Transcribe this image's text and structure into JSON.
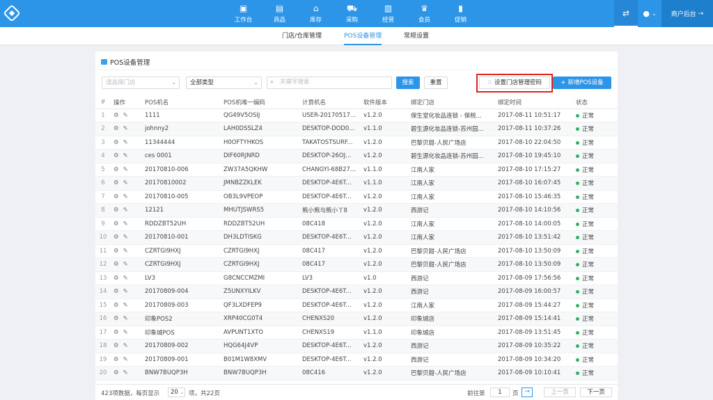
{
  "topnav": {
    "items": [
      {
        "label": "工作台",
        "icon": "monitor-icon",
        "glyph": "▣"
      },
      {
        "label": "商品",
        "icon": "product-icon",
        "glyph": "▤"
      },
      {
        "label": "库存",
        "icon": "warehouse-icon",
        "glyph": "⌂"
      },
      {
        "label": "采购",
        "icon": "cart-icon",
        "glyph": "⛟"
      },
      {
        "label": "经营",
        "icon": "store-icon",
        "glyph": "▥"
      },
      {
        "label": "会员",
        "icon": "crown-icon",
        "glyph": "♛"
      },
      {
        "label": "促销",
        "icon": "promotion-icon",
        "glyph": "▮"
      }
    ],
    "merchant_label": "商户后台",
    "merchant_arrow": "→",
    "settings_glyph": "⇄",
    "user_glyph": "●",
    "user_caret": "⌄"
  },
  "subnav": {
    "tabs": [
      "门店/仓库管理",
      "POS设备管理",
      "常规设置"
    ],
    "active": 1
  },
  "card": {
    "title": "POS设备管理"
  },
  "filters": {
    "store_placeholder": "请选择门店",
    "type_value": "全部类型",
    "search_placeholder": "关键字搜索",
    "search_button": "搜索",
    "reset_button": "重置",
    "set_password_button": "设置门店管理密码",
    "add_pos_button": "新增POS设备",
    "caret": "⌄",
    "search_glyph": "⌕",
    "grid_glyph": "⁙",
    "plus_glyph": "+"
  },
  "table": {
    "headers": [
      "#",
      "操作",
      "POS机名",
      "POS机唯一编码",
      "计算机名",
      "软件版本",
      "绑定门店",
      "绑定时间",
      "状态"
    ],
    "op_icons": {
      "settings": "⚙",
      "edit": "✎"
    },
    "rows": [
      {
        "num": "1",
        "name": "1111",
        "code": "QG49V5OSIJ",
        "computer": "USER-20170517...",
        "version": "v1.2.0",
        "store": "保生堂化妆品连锁 - 保税...",
        "time": "2017-08-11 10:51:17",
        "status": "正常"
      },
      {
        "num": "2",
        "name": "johnny2",
        "code": "LAH0DSSLZ4",
        "computer": "DESKTOP-DOD0...",
        "version": "v1.1.0",
        "store": "碧生源化妆品连锁-苏州园...",
        "time": "2017-08-11 10:37:26",
        "status": "正常"
      },
      {
        "num": "3",
        "name": "11344444",
        "code": "H0OFTYHKOS",
        "computer": "TAKATOSTSURF...",
        "version": "v1.2.0",
        "store": "巴黎贝甜-人民广场店",
        "time": "2017-08-10 22:04:50",
        "status": "正常"
      },
      {
        "num": "4",
        "name": "ces 0001",
        "code": "DIF60RJNRD",
        "computer": "DESKTOP-26OJ...",
        "version": "v1.2.0",
        "store": "碧生源化妆品连锁-苏州园...",
        "time": "2017-08-10 19:45:10",
        "status": "正常"
      },
      {
        "num": "5",
        "name": "20170810-006",
        "code": "ZW37A5QKHW",
        "computer": "CHANGYI-68B27...",
        "version": "v1.1.0",
        "store": "江南人家",
        "time": "2017-08-10 17:15:27",
        "status": "正常"
      },
      {
        "num": "6",
        "name": "20170810002",
        "code": "JMNBZZKLEK",
        "computer": "DESKTOP-4E6T...",
        "version": "v1.1.0",
        "store": "江南人家",
        "time": "2017-08-10 16:07:45",
        "status": "正常"
      },
      {
        "num": "7",
        "name": "20170810-005",
        "code": "OB3L9VPEOP",
        "computer": "DESKTOP-4E6T...",
        "version": "v1.2.0",
        "store": "江南人家",
        "time": "2017-08-10 15:46:35",
        "status": "正常"
      },
      {
        "num": "8",
        "name": "12121",
        "code": "MHUTJSWRS5",
        "computer": "熊小熊与熊小丫8",
        "version": "v1.2.0",
        "store": "西游记",
        "time": "2017-08-10 14:10:56",
        "status": "正常"
      },
      {
        "num": "9",
        "name": "RDDZBT52UH",
        "code": "RDDZBT52UH",
        "computer": "08C418",
        "version": "v1.2.0",
        "store": "江南人家",
        "time": "2017-08-10 14:00:05",
        "status": "正常"
      },
      {
        "num": "10",
        "name": "20170810-001",
        "code": "DH3LDTISKG",
        "computer": "DESKTOP-4E6T...",
        "version": "v1.2.0",
        "store": "江南人家",
        "time": "2017-08-10 13:51:42",
        "status": "正常"
      },
      {
        "num": "11",
        "name": "CZRTGI9HXJ",
        "code": "CZRTGI9HXJ",
        "computer": "08C417",
        "version": "v1.2.0",
        "store": "巴黎贝甜-人民广场店",
        "time": "2017-08-10 13:50:09",
        "status": "正常"
      },
      {
        "num": "12",
        "name": "CZRTGI9HXJ",
        "code": "CZRTGI9HXJ",
        "computer": "08C417",
        "version": "v1.2.0",
        "store": "巴黎贝甜-人民广场店",
        "time": "2017-08-10 13:50:09",
        "status": "正常"
      },
      {
        "num": "13",
        "name": "LV3",
        "code": "G8CNCCMZMI",
        "computer": "LV3",
        "version": "v1.0",
        "store": "西游记",
        "time": "2017-08-09 17:56:56",
        "status": "正常"
      },
      {
        "num": "14",
        "name": "20170809-004",
        "code": "Z5UNXYILKV",
        "computer": "DESKTOP-4E6T...",
        "version": "v1.2.0",
        "store": "西游记",
        "time": "2017-08-09 16:00:57",
        "status": "正常"
      },
      {
        "num": "15",
        "name": "20170809-003",
        "code": "QF3LXDFEP9",
        "computer": "DESKTOP-4E6T...",
        "version": "v1.2.0",
        "store": "江南人家",
        "time": "2017-08-09 15:44:27",
        "status": "正常"
      },
      {
        "num": "16",
        "name": "印象POS2",
        "code": "XRP40CG0T4",
        "computer": "CHENXS20",
        "version": "v1.2.0",
        "store": "印象城店",
        "time": "2017-08-09 15:14:41",
        "status": "正常"
      },
      {
        "num": "17",
        "name": "印象城POS",
        "code": "AVPUNT1XTO",
        "computer": "CHENXS19",
        "version": "v1.1.0",
        "store": "印象城店",
        "time": "2017-08-09 13:51:45",
        "status": "正常"
      },
      {
        "num": "18",
        "name": "20170809-002",
        "code": "HQG64J4VP",
        "computer": "DESKTOP-4E6T...",
        "version": "v1.2.0",
        "store": "西游记",
        "time": "2017-08-09 10:35:22",
        "status": "正常"
      },
      {
        "num": "19",
        "name": "20170809-001",
        "code": "B01M1W8XMV",
        "computer": "DESKTOP-4E6T...",
        "version": "v1.2.0",
        "store": "西游记",
        "time": "2017-08-09 10:34:20",
        "status": "正常"
      },
      {
        "num": "20",
        "name": "BNW7BUQP3H",
        "code": "BNW7BUQP3H",
        "computer": "08C416",
        "version": "v1.2.0",
        "store": "巴黎贝甜-人民广场店",
        "time": "2017-08-09 10:10:41",
        "status": "正常"
      }
    ]
  },
  "footer": {
    "total_prefix": "423项数据，每页显示",
    "page_size": "20",
    "page_size_caret": "⌄",
    "total_suffix": "项，共22页",
    "goto_label": "前往第",
    "goto_value": "1",
    "page_unit": "页",
    "go_glyph": "→",
    "prev_label": "上一页",
    "next_label": "下一页"
  },
  "colors": {
    "brand": "#2c95e8",
    "highlight": "#e0231b",
    "status_ok": "#2ab361"
  }
}
